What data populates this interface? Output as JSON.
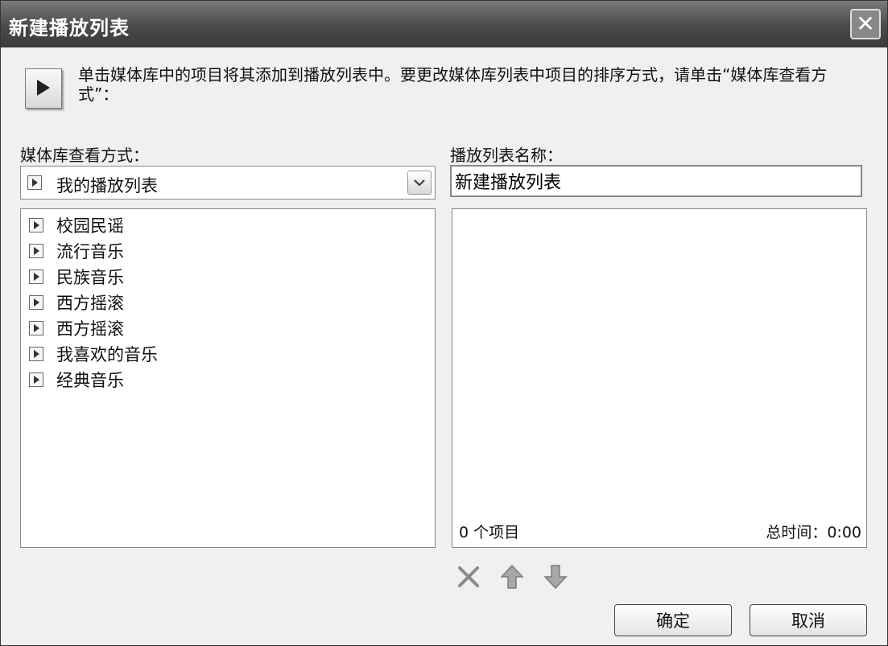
{
  "window": {
    "title": "新建播放列表",
    "close_symbol": "✕"
  },
  "info": {
    "icon": "media-play-icon",
    "text": "单击媒体库中的项目将其添加到播放列表中。要更改媒体库列表中项目的排序方式，请单击“媒体库查看方式”："
  },
  "library": {
    "label": "媒体库查看方式：",
    "view_selected": "我的播放列表",
    "items": [
      {
        "label": "校园民谣"
      },
      {
        "label": "流行音乐"
      },
      {
        "label": "民族音乐"
      },
      {
        "label": "西方摇滚"
      },
      {
        "label": "西方摇滚"
      },
      {
        "label": "我喜欢的音乐"
      },
      {
        "label": "经典音乐"
      }
    ]
  },
  "playlist": {
    "name_label": "播放列表名称：",
    "name_value": "新建播放列表",
    "count_text": "0 个项目",
    "total_time_text": "总时间：0:00"
  },
  "toolbar": {
    "remove_icon": "remove-x-icon",
    "move_up_icon": "move-up-arrow-icon",
    "move_down_icon": "move-down-arrow-icon"
  },
  "buttons": {
    "ok_label": "确定",
    "cancel_label": "取消"
  }
}
